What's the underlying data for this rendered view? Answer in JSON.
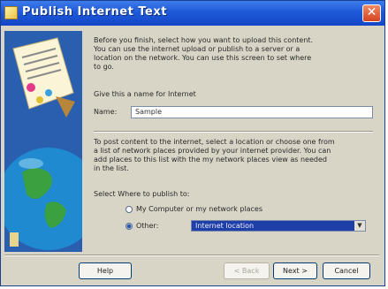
{
  "window": {
    "title": "Publish Internet Text",
    "close_symbol": "✕"
  },
  "intro_lines": [
    "Before you finish, select how you want to upload this content.",
    "You can use the internet upload or publish to a server or a",
    "location on the network. You can use this screen to set where",
    "to go."
  ],
  "name_section": {
    "label": "Give this a name for Internet",
    "field_label": "Name:",
    "field_value": "Sample"
  },
  "location_lines": [
    "To post content to the internet, select a location or choose one from",
    "a list of network places provided by your internet provider. You can",
    "add places to this list with the my network places view as needed",
    "in the list."
  ],
  "choose_label": "Select Where to publish to:",
  "radio_options": [
    {
      "label": "My Computer or my network places",
      "checked": false
    },
    {
      "label": "Other:",
      "checked": true
    }
  ],
  "dropdown_value": "Internet location",
  "buttons": {
    "help": "Help",
    "back": "< Back",
    "next": "Next >",
    "cancel": "Cancel"
  }
}
